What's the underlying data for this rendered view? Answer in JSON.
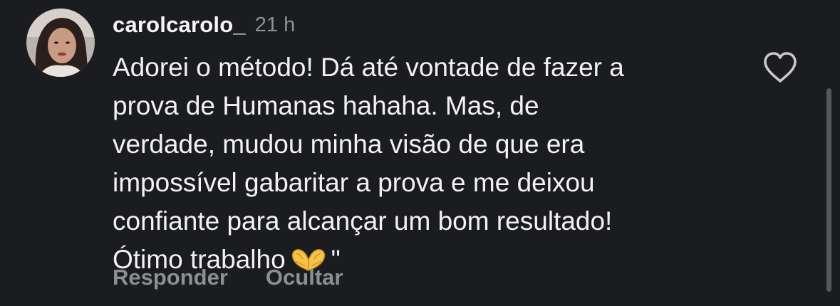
{
  "comment": {
    "username": "carolcarolo_",
    "time": "21 h",
    "avatar_icon": "profile-photo",
    "text_lines": [
      "Adorei o método! Dá até vontade de fazer a",
      "prova de Humanas hahaha. Mas, de",
      "verdade, mudou minha visão de que era",
      "impossível gabaritar a prova e me deixou",
      "confiante para alcançar um bom resultado!",
      "Ótimo trabalho"
    ],
    "text_end": "\"",
    "emoji": "heart-hands",
    "like_icon": "heart-outline-icon"
  },
  "actions": {
    "reply_label": "Responder",
    "hide_label": "Ocultar"
  },
  "colors": {
    "background": "#1b1c1f",
    "text": "#f2f2f2",
    "muted": "#8e8f94",
    "scrollbar": "#55565b"
  }
}
